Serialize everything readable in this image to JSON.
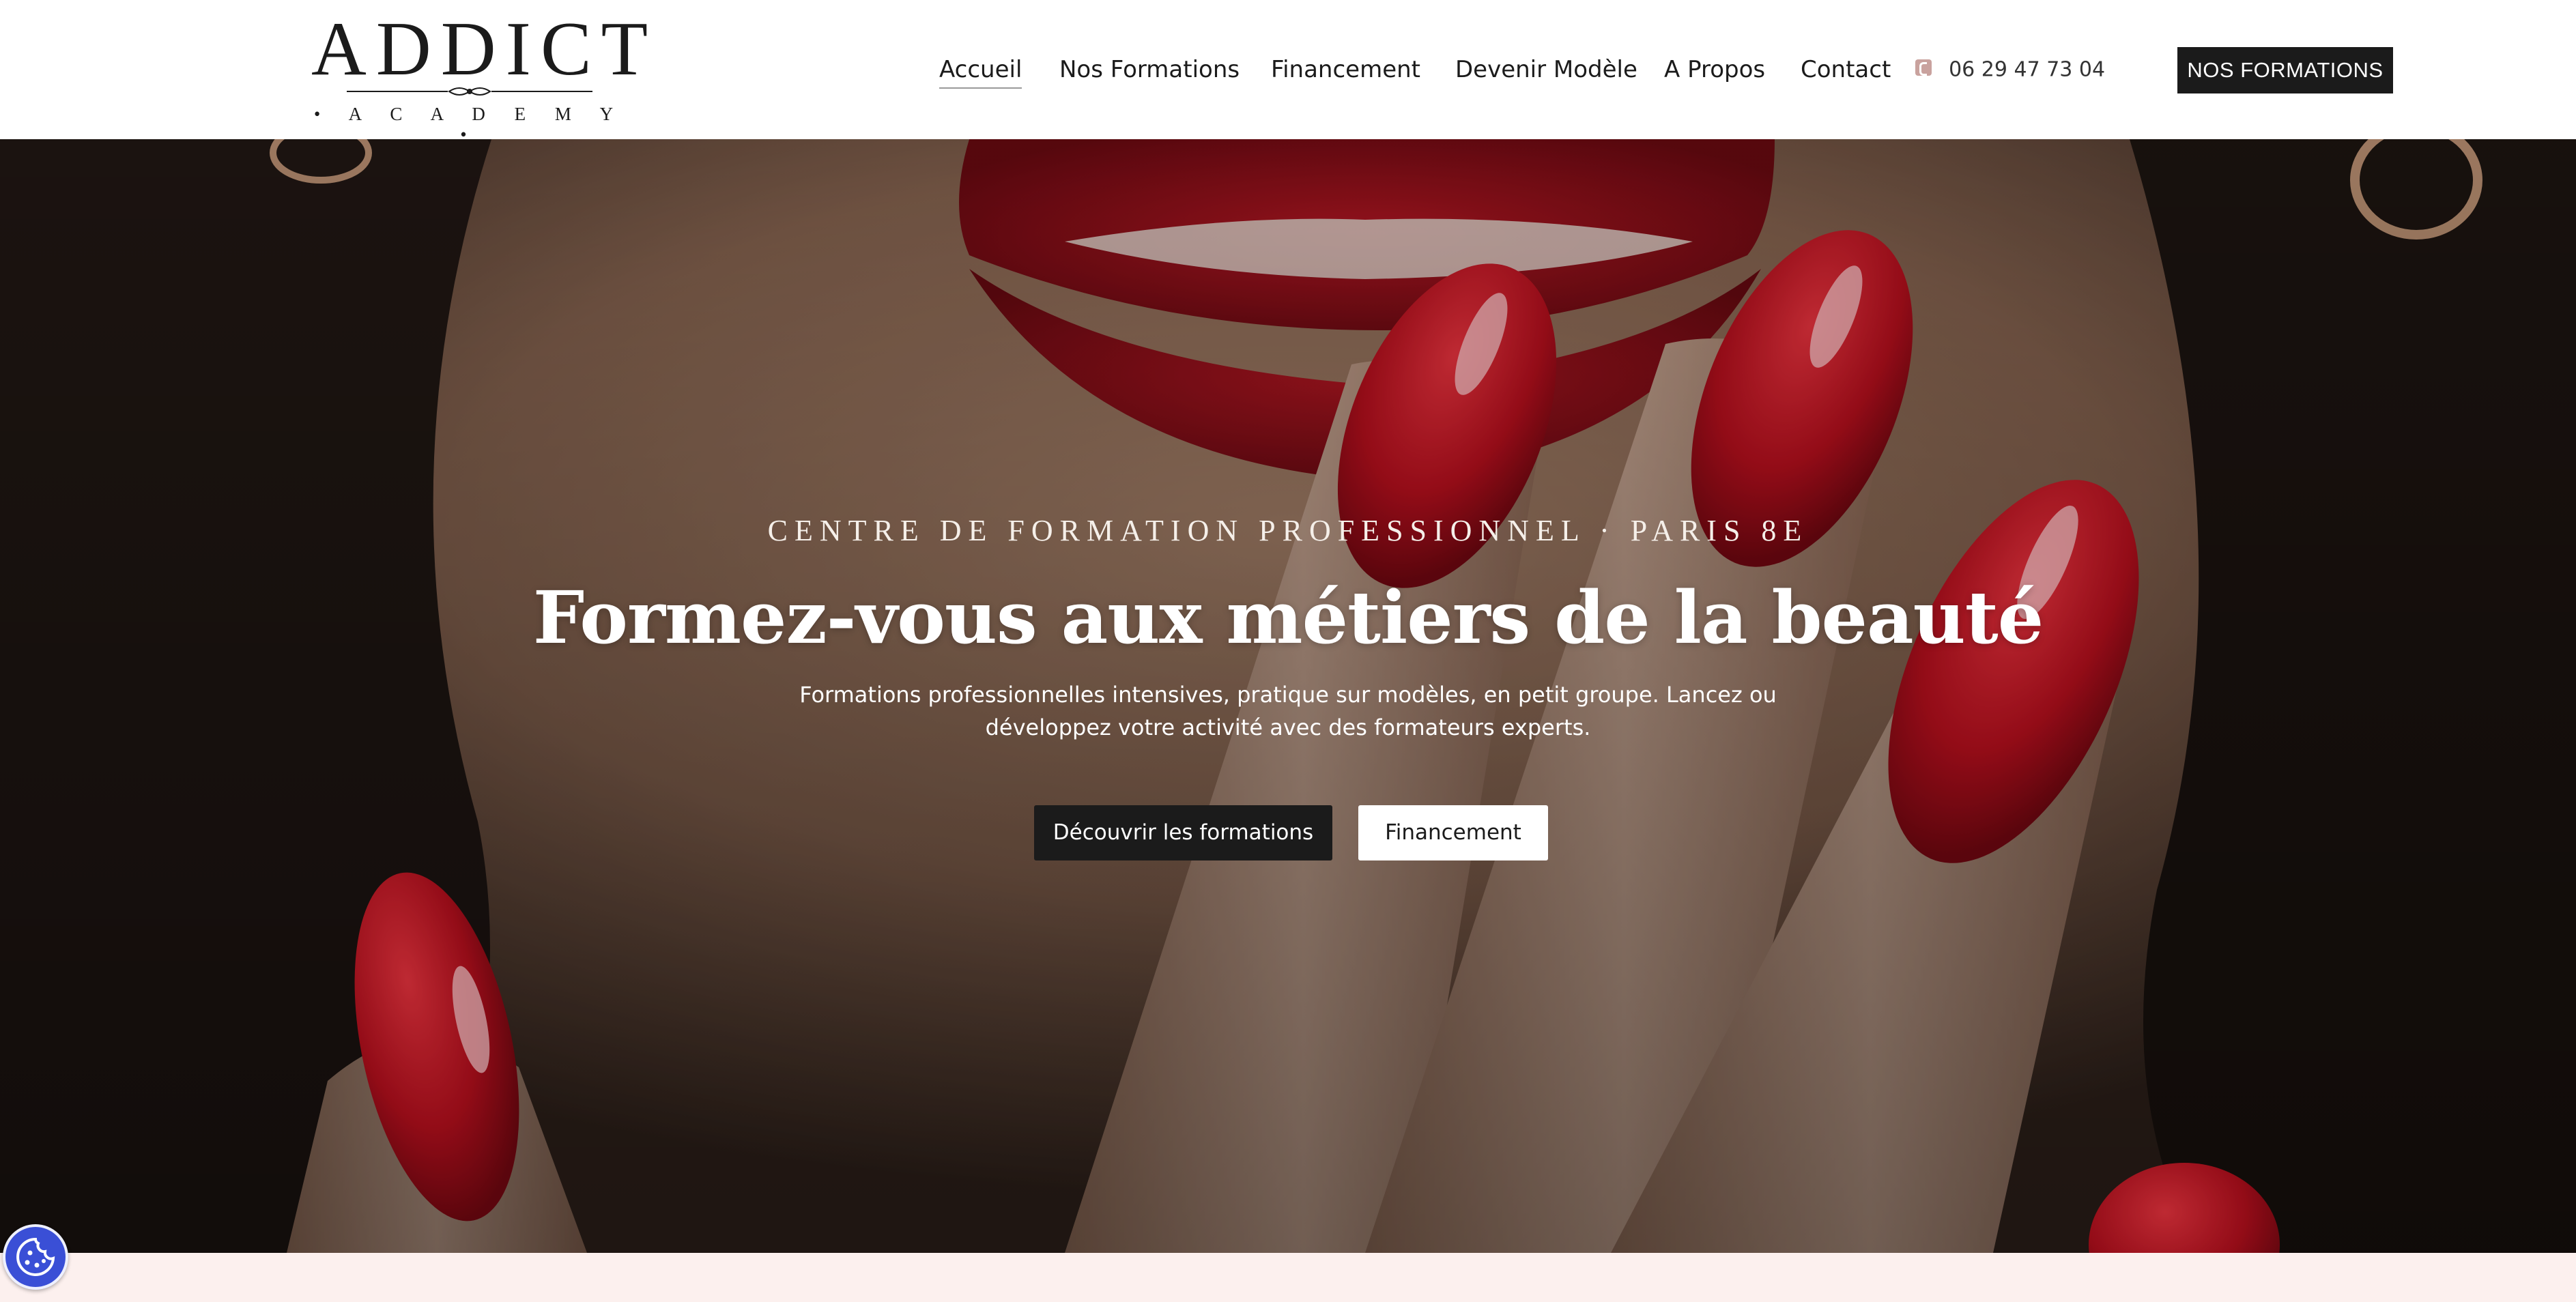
{
  "brand": {
    "name": "ADDICT",
    "subtitle": "• A C A D E M Y •"
  },
  "nav": {
    "items": [
      {
        "label": "Accueil",
        "active": true
      },
      {
        "label": "Nos Formations",
        "active": false
      },
      {
        "label": "Financement",
        "active": false
      },
      {
        "label": "Devenir Modèle",
        "active": false
      },
      {
        "label": "A Propos",
        "active": false
      },
      {
        "label": "Contact",
        "active": false
      }
    ],
    "phone": "06 29 47 73 04",
    "phone_icon": "phone-icon",
    "cta_label": "NOS FORMATIONS"
  },
  "hero": {
    "eyebrow": "CENTRE DE FORMATION PROFESSIONNEL · PARIS 8E",
    "headline": "Formez-vous aux métiers de la beauté",
    "subtext_line1": "Formations professionnelles intensives, pratique sur modèles, en petit groupe. Lancez ou",
    "subtext_line2": "développez votre activité avec des formateurs experts.",
    "primary_button": "Découvrir les formations",
    "secondary_button": "Financement",
    "background_icon": "red-nails-lips-photo"
  },
  "cookie": {
    "icon": "cookie-icon"
  },
  "colors": {
    "dark": "#1b1b1b",
    "accent_pink": "#c9a29e",
    "strip": "#fcf0ee",
    "cookie_blue": "#3a4fd6",
    "nail_red": "#c1121f"
  }
}
